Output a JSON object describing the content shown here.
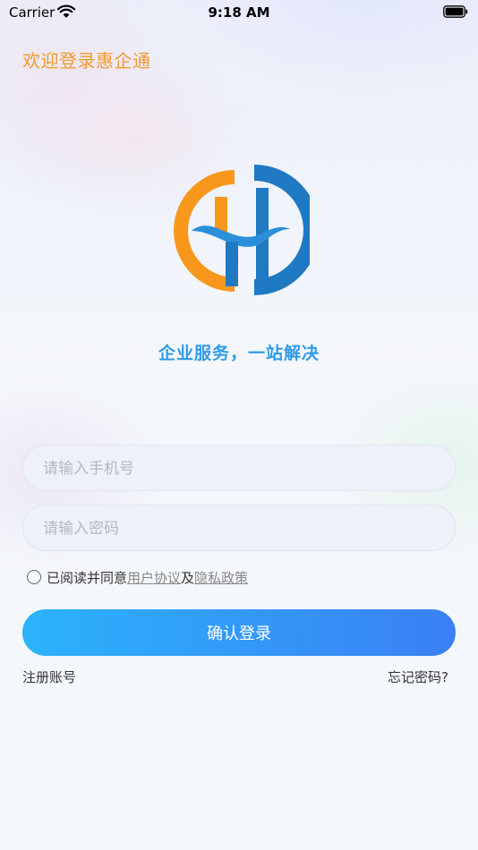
{
  "status_bar": {
    "carrier": "Carrier",
    "time": "9:18 AM"
  },
  "header": {
    "welcome": "欢迎登录惠企通"
  },
  "slogan": "企业服务，一站解决",
  "form": {
    "phone_placeholder": "请输入手机号",
    "password_placeholder": "请输入密码"
  },
  "agreement": {
    "prefix": "已阅读并同意",
    "user_agreement": "用户协议",
    "and": "及",
    "privacy_policy": "隐私政策"
  },
  "login_label": "确认登录",
  "register_label": "注册账号",
  "forgot_label": "忘记密码?",
  "colors": {
    "accent_orange": "#f39a2b",
    "accent_blue": "#2f9be9",
    "button_start": "#2bb3fb",
    "button_end": "#3a80f4"
  }
}
